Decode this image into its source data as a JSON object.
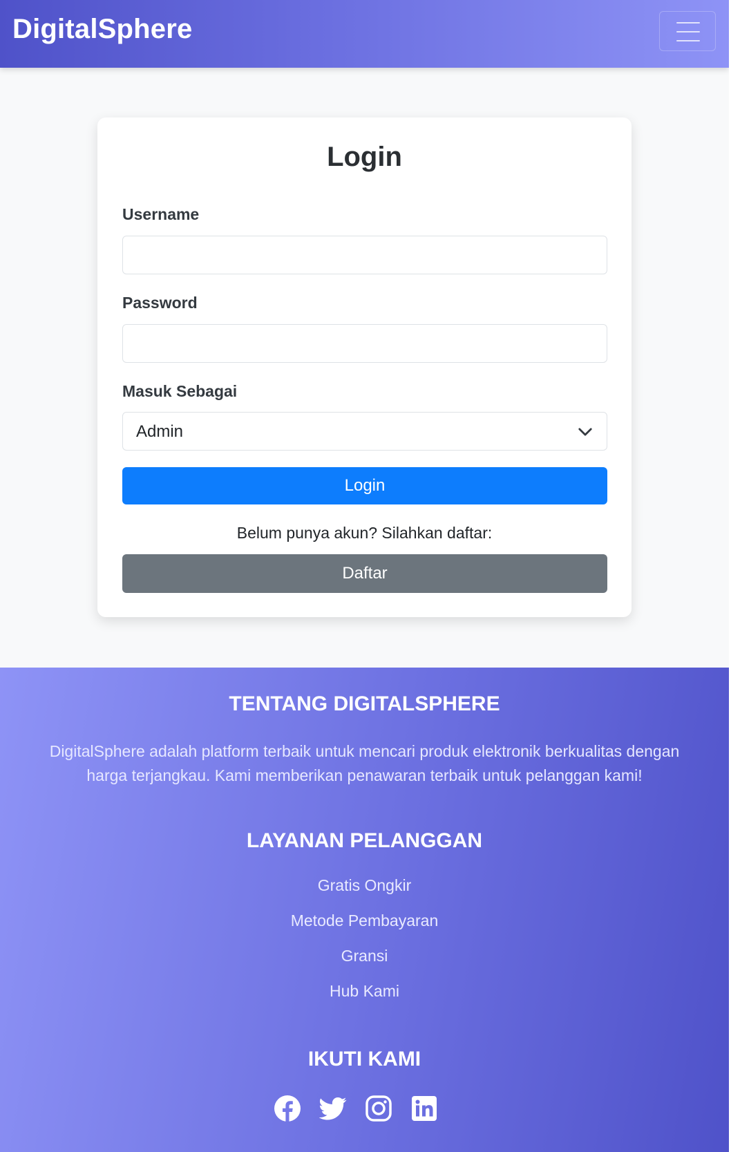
{
  "navbar": {
    "brand": "DigitalSphere",
    "menu_icon": "hamburger-menu-icon"
  },
  "login_form": {
    "title": "Login",
    "username_label": "Username",
    "username_value": "",
    "password_label": "Password",
    "password_value": "",
    "role_label": "Masuk Sebagai",
    "role_selected": "Admin",
    "login_button": "Login",
    "register_prompt": "Belum punya akun? Silahkan daftar:",
    "register_button": "Daftar"
  },
  "footer": {
    "about_heading": "TENTANG DIGITALSPHERE",
    "about_text": "DigitalSphere adalah platform terbaik untuk mencari produk elektronik berkualitas dengan harga terjangkau. Kami memberikan penawaran terbaik untuk pelanggan kami!",
    "service_heading": "LAYANAN PELANGGAN",
    "service_links": [
      "Gratis Ongkir",
      "Metode Pembayaran",
      "Gransi",
      "Hub Kami"
    ],
    "follow_heading": "IKUTI KAMI",
    "social_icons": [
      "facebook-icon",
      "twitter-icon",
      "instagram-icon",
      "linkedin-icon"
    ]
  },
  "colors": {
    "nav_gradient_start": "#4f52c9",
    "nav_gradient_end": "#8e93f6",
    "primary_button": "#0d7dfd",
    "secondary_button": "#6c757d",
    "page_background": "#f8f9fa"
  }
}
